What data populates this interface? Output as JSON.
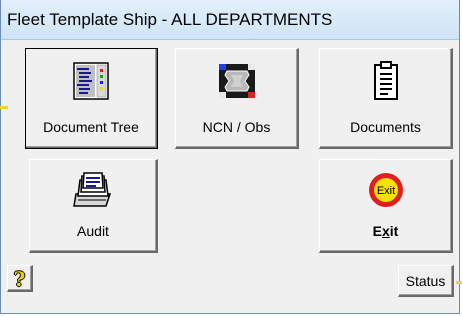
{
  "window": {
    "title": "Fleet Template Ship - ALL DEPARTMENTS"
  },
  "buttons": {
    "document_tree": {
      "label": "Document Tree",
      "icon": "document-tree-icon"
    },
    "ncn_obs": {
      "label": "NCN / Obs",
      "icon": "ncn-obs-icon"
    },
    "documents": {
      "label": "Documents",
      "icon": "clipboard-icon"
    },
    "audit": {
      "label": "Audit",
      "icon": "file-cards-icon"
    },
    "exit": {
      "label": "Exit",
      "mnemonic": "x",
      "icon": "exit-sign-icon",
      "icon_text": "Exit"
    },
    "help": {
      "glyph": "?",
      "icon": "help-icon"
    },
    "status": {
      "label": "Status"
    }
  },
  "colors": {
    "title_bar": "#cfe4f6",
    "face": "#f0f0f0",
    "exit_yellow": "#f5e100",
    "exit_red": "#e01e1e",
    "marker": "#f4d03f"
  }
}
